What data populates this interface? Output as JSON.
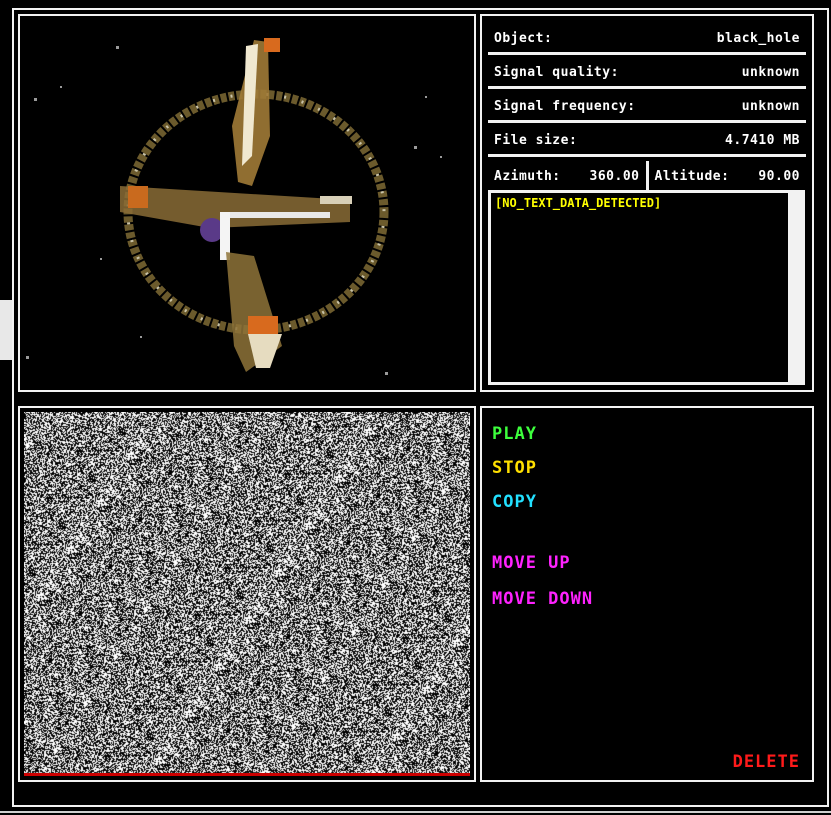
{
  "info": {
    "object": {
      "label": "Object:",
      "value": "black_hole"
    },
    "signal_quality": {
      "label": "Signal quality:",
      "value": "unknown"
    },
    "signal_frequency": {
      "label": "Signal frequency:",
      "value": "unknown"
    },
    "file_size": {
      "label": "File size:",
      "value": "4.7410 MB"
    },
    "azimuth": {
      "label": "Azimuth:",
      "value": "360.00"
    },
    "altitude": {
      "label": "Altitude:",
      "value": "90.00"
    },
    "text_data": "[NO_TEXT_DATA_DETECTED]"
  },
  "controls": {
    "play": "PLAY",
    "stop": "STOP",
    "copy": "COPY",
    "move_up": "MOVE UP",
    "move_down": "MOVE DOWN",
    "delete": "DELETE"
  },
  "colors": {
    "play": "#3dff3d",
    "stop": "#ffe000",
    "copy": "#22e0ff",
    "move": "#ff22ff",
    "delete": "#ff1a1a",
    "text_data": "#ffff00"
  }
}
